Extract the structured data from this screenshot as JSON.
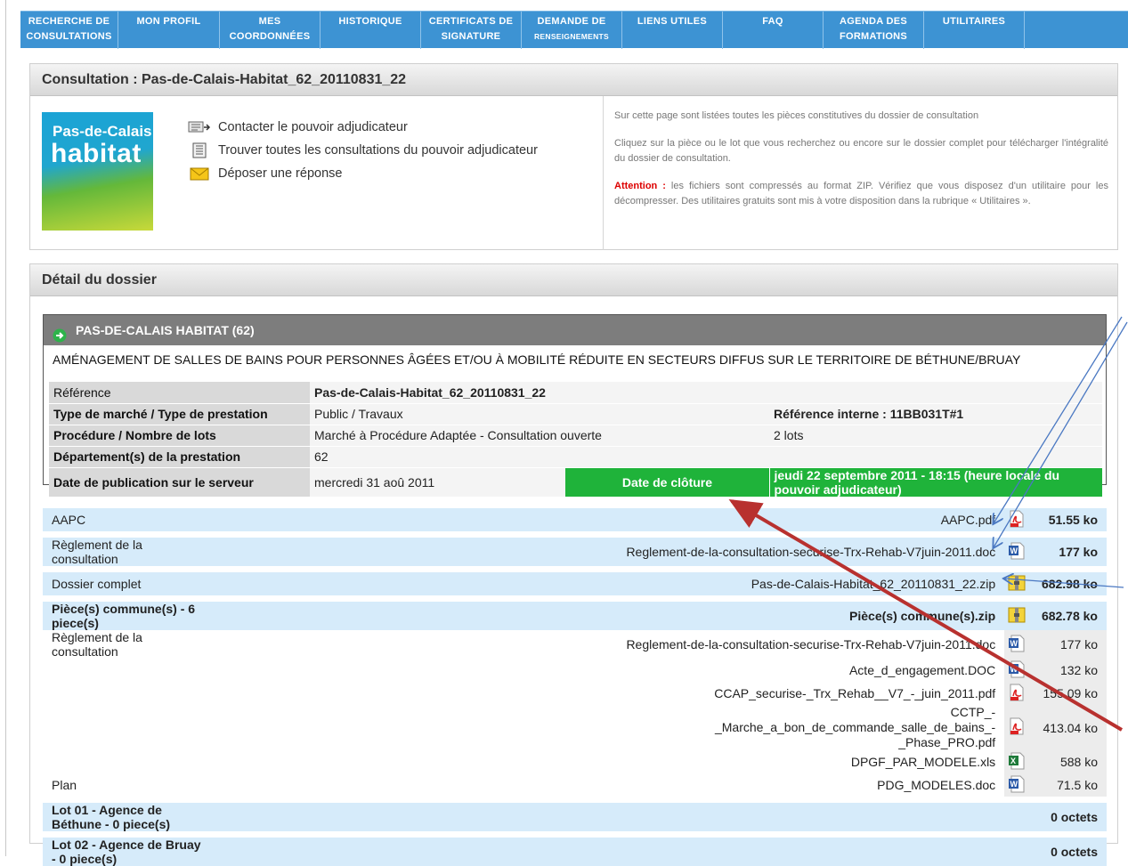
{
  "nav": [
    {
      "line1": "RECHERCHE DE",
      "line2": "CONSULTATIONS"
    },
    {
      "line1": "MON PROFIL",
      "line2": ""
    },
    {
      "line1": "MES",
      "line2": "COORDONNÉES"
    },
    {
      "line1": "HISTORIQUE",
      "line2": ""
    },
    {
      "line1": "CERTIFICATS DE",
      "line2": "SIGNATURE"
    },
    {
      "line1": "DEMANDE DE",
      "line2": "RENSEIGNEMENTS"
    },
    {
      "line1": "LIENS UTILES",
      "line2": ""
    },
    {
      "line1": "FAQ",
      "line2": ""
    },
    {
      "line1": "AGENDA DES",
      "line2": "FORMATIONS"
    },
    {
      "line1": "UTILITAIRES",
      "line2": ""
    }
  ],
  "consultation": {
    "title": "Consultation : Pas-de-Calais-Habitat_62_20110831_22",
    "logo": {
      "line1": "Pas-de-Calais",
      "line2": "habitat"
    },
    "actions": [
      "Contacter le pouvoir adjudicateur",
      "Trouver toutes les consultations du pouvoir adjudicateur",
      "Déposer une réponse"
    ],
    "info": {
      "p1": "Sur cette page sont listées toutes les pièces constitutives du dossier de consultation",
      "p2": "Cliquez sur la pièce ou le lot que vous recherchez ou encore sur le dossier complet pour télécharger l'intégralité du dossier de consultation.",
      "attention_label": "Attention :",
      "p3": " les fichiers sont compressés au format ZIP. Vérifiez que vous disposez d'un utilitaire pour les décompresser. Des utilitaires gratuits sont mis à votre disposition dans la rubrique « Utilitaires »."
    }
  },
  "detail": {
    "heading": "Détail du dossier",
    "org": "PAS-DE-CALAIS HABITAT (62)",
    "object": "AMÉNAGEMENT DE SALLES DE BAINS POUR PERSONNES ÂGÉES ET/OU À MOBILITÉ RÉDUITE EN SECTEURS DIFFUS SUR LE TERRITOIRE DE BÉTHUNE/BRUAY",
    "rows": {
      "reference_label": "Référence",
      "reference": "Pas-de-Calais-Habitat_62_20110831_22",
      "type_label": "Type de marché / Type de prestation",
      "type": "Public / Travaux",
      "ref_interne": "Référence interne : 11BB031T#1",
      "procedure_label": "Procédure / Nombre de lots",
      "procedure": "Marché à Procédure Adaptée - Consultation ouverte",
      "lots": "2 lots",
      "dept_label": "Département(s) de la prestation",
      "dept": "62",
      "pub_label": "Date de publication sur le serveur",
      "pub": "mercredi 31 aoû 2011",
      "cloture_label": "Date de clôture",
      "cloture": "jeudi 22 septembre 2011 - 18:15 (heure locale du pouvoir adjudicateur)"
    }
  },
  "files": [
    {
      "label": "AAPC",
      "file": "AAPC.pdf",
      "icon": "pdf-icon",
      "size": "51.55 ko",
      "style": "blue"
    },
    {
      "label": "Règlement de la consultation",
      "file": "Reglement-de-la-consultation-securise-Trx-Rehab-V7juin-2011.doc",
      "icon": "word-icon",
      "size": "177 ko",
      "style": "blue"
    },
    {
      "label": "Dossier complet",
      "file": "Pas-de-Calais-Habitat_62_20110831_22.zip",
      "icon": "zip-icon",
      "size": "682.98 ko",
      "style": "blue"
    },
    {
      "label": "Pièce(s) commune(s) - 6 piece(s)",
      "file": "Pièce(s) commune(s).zip",
      "icon": "zip-icon",
      "size": "682.78 ko",
      "style": "blue-bold"
    },
    {
      "label": "Règlement de la consultation",
      "file": "Reglement-de-la-consultation-securise-Trx-Rehab-V7juin-2011.doc",
      "icon": "word-icon",
      "size": "177 ko",
      "style": "sub"
    },
    {
      "label": "",
      "file": "Acte_d_engagement.DOC",
      "icon": "word-icon",
      "size": "132 ko",
      "style": "sub"
    },
    {
      "label": "",
      "file": "CCAP_securise-_Trx_Rehab__V7_-_juin_2011.pdf",
      "icon": "pdf-icon",
      "size": "155.09 ko",
      "style": "sub"
    },
    {
      "label": "",
      "file": "CCTP_-_Marche_a_bon_de_commande_salle_de_bains_-_Phase_PRO.pdf",
      "icon": "pdf-icon",
      "size": "413.04 ko",
      "style": "sub-tall"
    },
    {
      "label": "",
      "file": "DPGF_PAR_MODELE.xls",
      "icon": "excel-icon",
      "size": "588 ko",
      "style": "sub"
    },
    {
      "label": "Plan",
      "file": "PDG_MODELES.doc",
      "icon": "word-icon",
      "size": "71.5 ko",
      "style": "sub"
    },
    {
      "label": "Lot 01 - Agence de Béthune - 0 piece(s)",
      "file": "",
      "icon": "",
      "size": "0 octets",
      "style": "blue-bold"
    },
    {
      "label": "Lot 02 - Agence de Bruay - 0 piece(s)",
      "file": "",
      "icon": "",
      "size": "0 octets",
      "style": "blue-bold"
    }
  ]
}
